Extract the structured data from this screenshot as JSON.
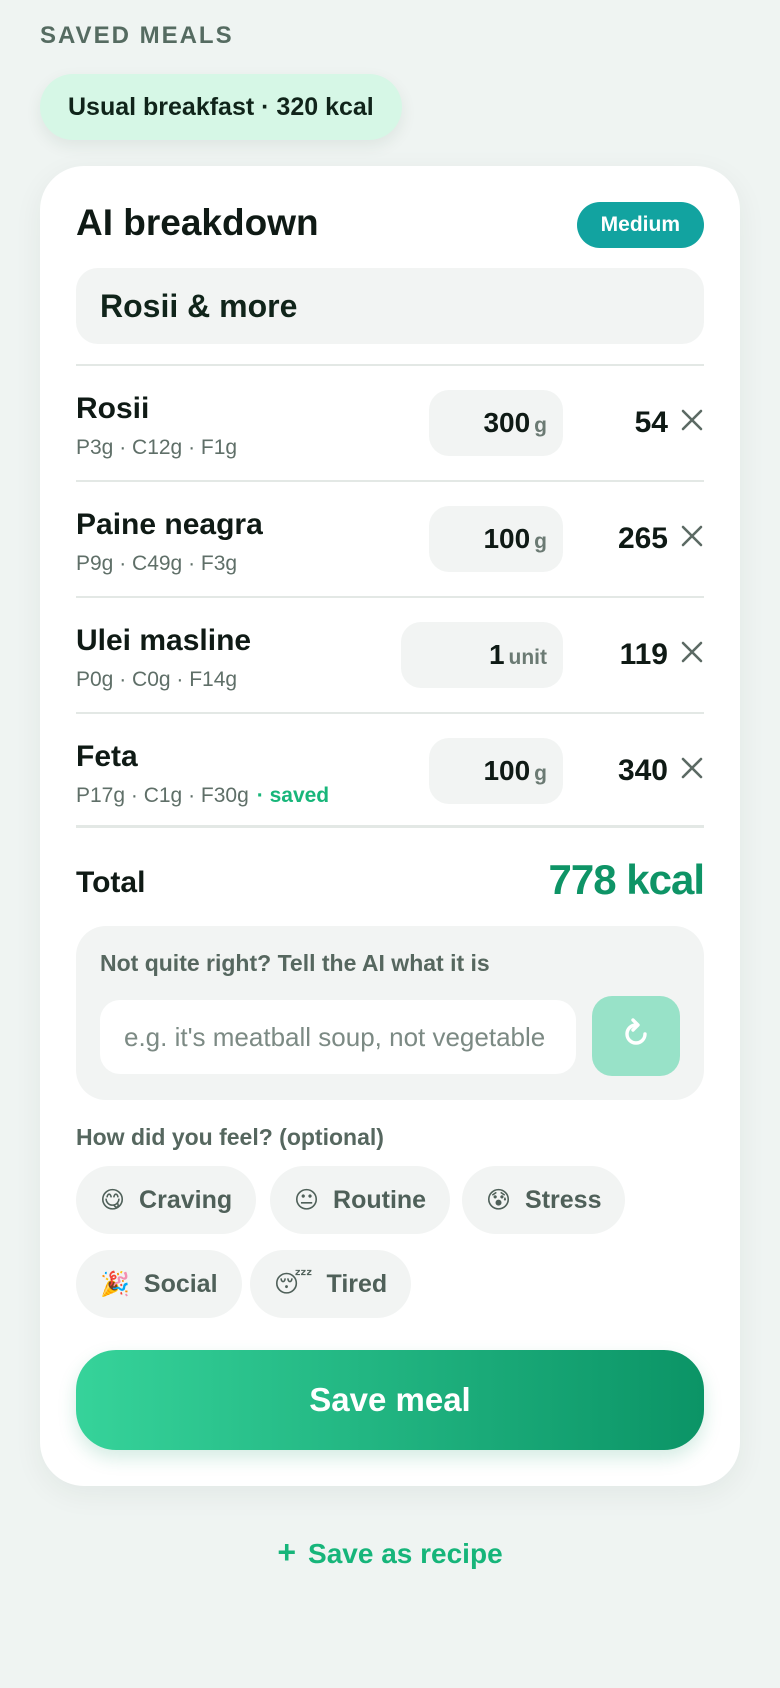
{
  "saved_meals": {
    "label": "SAVED MEALS",
    "chips": [
      "Usual breakfast · 320 kcal"
    ]
  },
  "breakdown": {
    "title": "AI breakdown",
    "confidence": "Medium",
    "meal_name": "Rosii & more",
    "items": [
      {
        "name": "Rosii",
        "macros": "P3g · C12g · F1g",
        "saved": "",
        "qty": "300",
        "unit": "g",
        "kcal": "54"
      },
      {
        "name": "Paine neagra",
        "macros": "P9g · C49g · F3g",
        "saved": "",
        "qty": "100",
        "unit": "g",
        "kcal": "265"
      },
      {
        "name": "Ulei masline",
        "macros": "P0g · C0g · F14g",
        "saved": "",
        "qty": "1",
        "unit": "unit",
        "kcal": "119"
      },
      {
        "name": "Feta",
        "macros": "P17g · C1g · F30g",
        "saved": "· saved",
        "qty": "100",
        "unit": "g",
        "kcal": "340"
      }
    ],
    "total_label": "Total",
    "total_value": "778 kcal"
  },
  "correction": {
    "prompt": "Not quite right? Tell the AI what it is",
    "placeholder": "e.g. it's meatball soup, not vegetable stew",
    "retry_icon": "refresh-icon"
  },
  "mood": {
    "label": "How did you feel? (optional)",
    "options": [
      {
        "emoji": "😋",
        "label": "Craving"
      },
      {
        "emoji": "😐",
        "label": "Routine"
      },
      {
        "emoji": "😰",
        "label": "Stress"
      },
      {
        "emoji": "🎉",
        "label": "Social"
      },
      {
        "emoji": "😴",
        "label": "Tired"
      }
    ]
  },
  "actions": {
    "save_label": "Save meal",
    "recipe_plus": "+",
    "recipe_label": "Save as recipe"
  },
  "colors": {
    "accent": "#0e9466",
    "badge": "#12a3a0",
    "chip_bg": "#d6f7e6"
  }
}
